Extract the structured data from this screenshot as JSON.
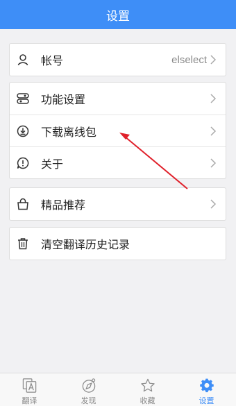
{
  "header": {
    "title": "设置"
  },
  "sections": {
    "account": {
      "label": "帐号",
      "value": "elselect"
    },
    "features": {
      "label": "功能设置"
    },
    "offline": {
      "label": "下载离线包"
    },
    "about": {
      "label": "关于"
    },
    "recommend": {
      "label": "精品推荐"
    },
    "clear": {
      "label": "清空翻译历史记录"
    }
  },
  "tabbar": {
    "items": [
      {
        "label": "翻译",
        "icon": "translate-icon"
      },
      {
        "label": "发现",
        "icon": "compass-icon"
      },
      {
        "label": "收藏",
        "icon": "star-icon"
      },
      {
        "label": "设置",
        "icon": "gear-icon",
        "active": true
      }
    ]
  },
  "colors": {
    "accent": "#3e8ef7",
    "annotation_arrow": "#e0202a"
  }
}
